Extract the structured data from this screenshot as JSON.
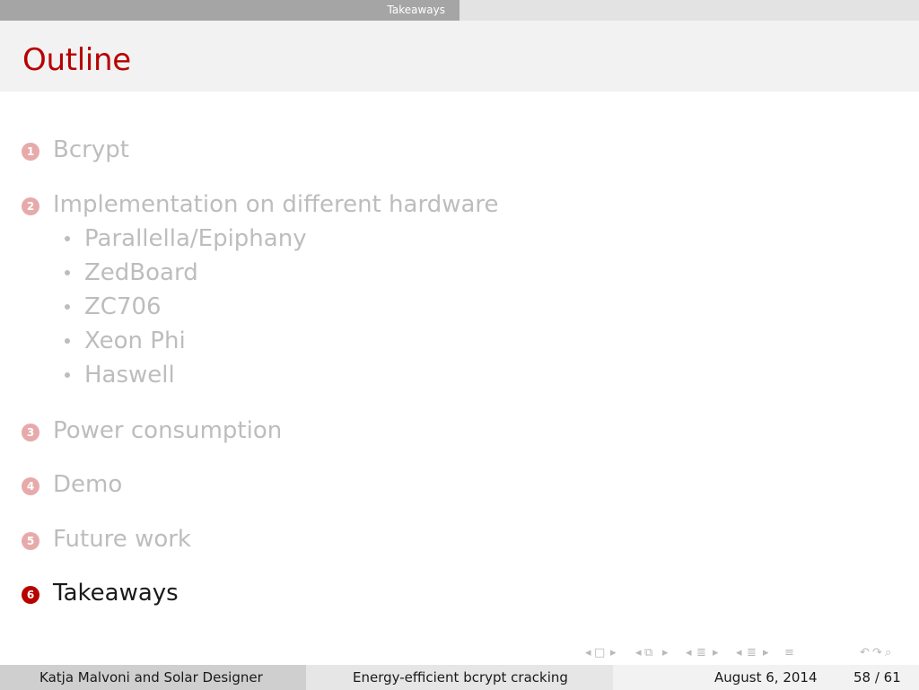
{
  "nav": {
    "section_label": "Takeaways"
  },
  "title": "Outline",
  "outline": {
    "sections": [
      {
        "number": "1",
        "label": "Bcrypt",
        "subitems": []
      },
      {
        "number": "2",
        "label": "Implementation on different hardware",
        "subitems": [
          "Parallella/Epiphany",
          "ZedBoard",
          "ZC706",
          "Xeon Phi",
          "Haswell"
        ]
      },
      {
        "number": "3",
        "label": "Power consumption",
        "subitems": []
      },
      {
        "number": "4",
        "label": "Demo",
        "subitems": []
      },
      {
        "number": "5",
        "label": "Future work",
        "subitems": []
      },
      {
        "number": "6",
        "label": "Takeaways",
        "subitems": []
      }
    ],
    "current_section": "6"
  },
  "colors": {
    "accent": "#b80000",
    "faded_text": "#bdbdbd",
    "faded_number": "#e7aaaa"
  },
  "icons": {
    "frame_nav": "frame-navigation-icon",
    "subsection_nav": "subsection-navigation-icon",
    "section_nav": "section-navigation-icon",
    "appendix_nav": "appendix-navigation-icon",
    "align": "align-icon",
    "search": "search-icon",
    "back": "back-icon",
    "forward": "forward-icon"
  },
  "footer": {
    "authors": "Katja Malvoni and Solar Designer",
    "talk_title": "Energy-efficient bcrypt cracking",
    "date": "August 6, 2014",
    "page": "58 / 61"
  }
}
